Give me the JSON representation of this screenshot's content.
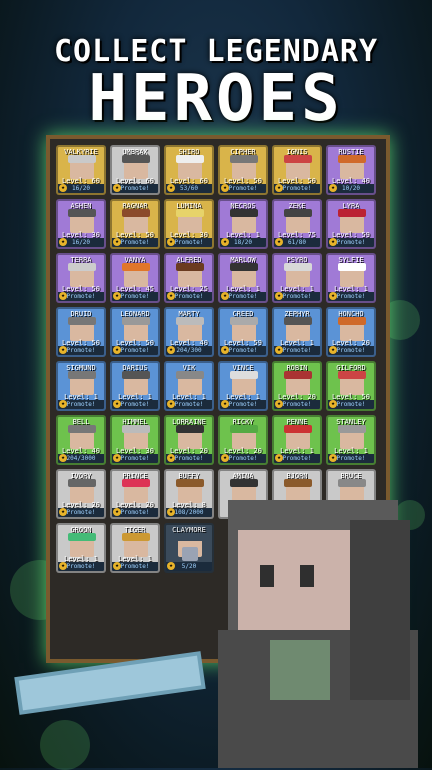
{
  "title": {
    "line1": "COLLECT LEGENDARY",
    "line2": "HEROES"
  },
  "colors": {
    "green": "#6ec24d",
    "blue": "#5b93d6",
    "purple": "#a07ad6",
    "gold": "#d9b44a",
    "gray": "#c9c9c9",
    "dark": "#3a4a5a"
  },
  "cards": [
    {
      "name": "VALKYRIE",
      "level": "Level: 60",
      "footer": "16/20",
      "color": "gold",
      "hair": "#c9c9c9"
    },
    {
      "name": "UMBRAX",
      "level": "Level: 60",
      "footer": "Promote!",
      "color": "gray",
      "hair": "#555"
    },
    {
      "name": "SHIRO",
      "level": "Level: 60",
      "footer": "53/60",
      "color": "gold",
      "hair": "#eee"
    },
    {
      "name": "CIPHER",
      "level": "Level: 50",
      "footer": "Promote!",
      "color": "gold",
      "hair": "#777"
    },
    {
      "name": "IGNIS",
      "level": "Level: 50",
      "footer": "Promote!",
      "color": "gold",
      "hair": "#c44"
    },
    {
      "name": "RUSTIE",
      "level": "Level: 40",
      "footer": "10/20",
      "color": "purple",
      "hair": "#d06a2a"
    },
    {
      "name": "ASHEN",
      "level": "Level: 30",
      "footer": "16/20",
      "color": "purple",
      "hair": "#555"
    },
    {
      "name": "RAGNAR",
      "level": "Level: 50",
      "footer": "Promote!",
      "color": "gold",
      "hair": "#8b4a2b"
    },
    {
      "name": "LUMINA",
      "level": "Level: 30",
      "footer": "Promote!",
      "color": "gold",
      "hair": "#e7d36a"
    },
    {
      "name": "NECROS",
      "level": "Level: 1",
      "footer": "18/20",
      "color": "purple",
      "hair": "#333"
    },
    {
      "name": "ZEKE",
      "level": "Level: 75",
      "footer": "61/80",
      "color": "purple",
      "hair": "#444"
    },
    {
      "name": "LYRA",
      "level": "Level: 59",
      "footer": "Promote!",
      "color": "purple",
      "hair": "#b23"
    },
    {
      "name": "TERRA",
      "level": "Level: 50",
      "footer": "Promote!",
      "color": "purple",
      "hair": "#ccc"
    },
    {
      "name": "VANYA",
      "level": "Level: 45",
      "footer": "Promote!",
      "color": "purple",
      "hair": "#e0762a"
    },
    {
      "name": "ALFRED",
      "level": "Level: 25",
      "footer": "Promote!",
      "color": "purple",
      "hair": "#6b3b1f"
    },
    {
      "name": "MARLOW",
      "level": "Level: 1",
      "footer": "Promote!",
      "color": "purple",
      "hair": "#333"
    },
    {
      "name": "PSYRO",
      "level": "Level: 1",
      "footer": "Promote!",
      "color": "purple",
      "hair": "#d8d8d8"
    },
    {
      "name": "SYLFIE",
      "level": "Level: 1",
      "footer": "Promote!",
      "color": "purple",
      "hair": "#fff"
    },
    {
      "name": "DRUID",
      "level": "Level: 50",
      "footer": "Promote!",
      "color": "blue",
      "hair": "#777"
    },
    {
      "name": "LEONARD",
      "level": "Level: 50",
      "footer": "Promote!",
      "color": "blue",
      "hair": "#999"
    },
    {
      "name": "MARTY",
      "level": "Level: 40",
      "footer": "204/300",
      "color": "blue",
      "hair": "#bbb"
    },
    {
      "name": "CREED",
      "level": "Level: 59",
      "footer": "Promote!",
      "color": "blue",
      "hair": "#aaa"
    },
    {
      "name": "ZEPHYR",
      "level": "Level: 1",
      "footer": "Promote!",
      "color": "blue",
      "hair": "#555"
    },
    {
      "name": "HONCHO",
      "level": "Level: 20",
      "footer": "Promote!",
      "color": "blue",
      "hair": "#cf6a2a"
    },
    {
      "name": "SIGMUND",
      "level": "Level: 1",
      "footer": "Promote!",
      "color": "blue",
      "hair": "#777"
    },
    {
      "name": "DARIUS",
      "level": "Level: 1",
      "footer": "Promote!",
      "color": "blue",
      "hair": "#555"
    },
    {
      "name": "VIK",
      "level": "Level: 1",
      "footer": "Promote!",
      "color": "blue",
      "hair": "#888"
    },
    {
      "name": "VINCE",
      "level": "Level: 1",
      "footer": "Promote!",
      "color": "blue",
      "hair": "#ddd"
    },
    {
      "name": "ROBIN",
      "level": "Level: 20",
      "footer": "Promote!",
      "color": "green",
      "hair": "#a33"
    },
    {
      "name": "GILFORD",
      "level": "Level: 50",
      "footer": "Promote!",
      "color": "green",
      "hair": "#c44"
    },
    {
      "name": "BELL",
      "level": "Level: 40",
      "footer": "204/3000",
      "color": "green",
      "hair": "#777"
    },
    {
      "name": "HIMMEL",
      "level": "Level: 30",
      "footer": "Promote!",
      "color": "green",
      "hair": "#bbb"
    },
    {
      "name": "LORRAINE",
      "level": "Level: 20",
      "footer": "Promote!",
      "color": "green",
      "hair": "#333"
    },
    {
      "name": "RICKY",
      "level": "Level: 20",
      "footer": "Promote!",
      "color": "green",
      "hair": "#5a4"
    },
    {
      "name": "PENNE",
      "level": "Level: 1",
      "footer": "Promote!",
      "color": "green",
      "hair": "#c33"
    },
    {
      "name": "STANLEY",
      "level": "Level: 1",
      "footer": "Promote!",
      "color": "green",
      "hair": "#999"
    },
    {
      "name": "IVORY",
      "level": "Level: 20",
      "footer": "Promote!",
      "color": "gray",
      "hair": "#666"
    },
    {
      "name": "PRINCE",
      "level": "Level: 20",
      "footer": "Promote!",
      "color": "gray",
      "hair": "#d35"
    },
    {
      "name": "BUFFY",
      "level": "Level: 8",
      "footer": "108/2000",
      "color": "gray",
      "hair": "#8b5a2b"
    },
    {
      "name": "AMINA",
      "level": "",
      "footer": "",
      "color": "gray",
      "hair": "#333"
    },
    {
      "name": "BJORN",
      "level": "",
      "footer": "",
      "color": "gray",
      "hair": "#8b5a2b"
    },
    {
      "name": "BRUCE",
      "level": "",
      "footer": "",
      "color": "gray",
      "hair": "#888"
    },
    {
      "name": "GROON",
      "level": "Level: 1",
      "footer": "Promote!",
      "color": "gray",
      "hair": "#4b7"
    },
    {
      "name": "TIGER",
      "level": "Level: 1",
      "footer": "Promote!",
      "color": "gray",
      "hair": "#c93"
    },
    {
      "name": "CLAYMORE",
      "level": "",
      "footer": "5/20",
      "color": "dark",
      "hair": "#3a4a5a",
      "locked": true
    }
  ]
}
